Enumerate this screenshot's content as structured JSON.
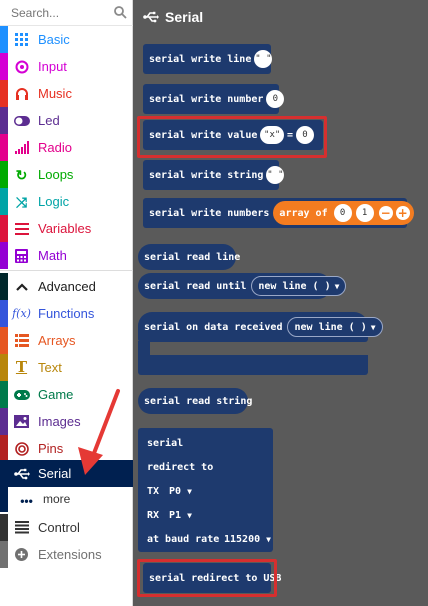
{
  "search": {
    "placeholder": "Search..."
  },
  "categories": [
    {
      "label": "Basic",
      "icon": "grid-icon",
      "color": "#1e90ff"
    },
    {
      "label": "Input",
      "icon": "target-icon",
      "color": "#d400d4"
    },
    {
      "label": "Music",
      "icon": "headphones-icon",
      "color": "#e63022"
    },
    {
      "label": "Led",
      "icon": "toggle-icon",
      "color": "#5c2d91"
    },
    {
      "label": "Radio",
      "icon": "signal-bars-icon",
      "color": "#e3008c"
    },
    {
      "label": "Loops",
      "icon": "loop-arrow-icon",
      "color": "#00aa00"
    },
    {
      "label": "Logic",
      "icon": "shuffle-icon",
      "color": "#00a4a6"
    },
    {
      "label": "Variables",
      "icon": "list-lines-icon",
      "color": "#dc143c"
    },
    {
      "label": "Math",
      "icon": "calculator-icon",
      "color": "#9400d3"
    }
  ],
  "advanced": [
    {
      "label": "Advanced",
      "icon": "chevron-up-icon",
      "color": "#00272b"
    },
    {
      "label": "Functions",
      "icon": "function-icon",
      "color": "#3455db"
    },
    {
      "label": "Arrays",
      "icon": "array-list-icon",
      "color": "#e65722"
    },
    {
      "label": "Text",
      "icon": "text-t-icon",
      "color": "#b8860b"
    },
    {
      "label": "Game",
      "icon": "gamepad-icon",
      "color": "#007a4b"
    },
    {
      "label": "Images",
      "icon": "image-icon",
      "color": "#5c2d91"
    },
    {
      "label": "Pins",
      "icon": "pin-target-icon",
      "color": "#b22222"
    },
    {
      "label": "Serial",
      "icon": "usb-icon",
      "color": "#002050"
    },
    {
      "label": "more",
      "icon": "dots-icon",
      "color": "#002050"
    },
    {
      "label": "Control",
      "icon": "control-lines-icon",
      "color": "#333333"
    },
    {
      "label": "Extensions",
      "icon": "plus-circle-icon",
      "color": "#717171"
    }
  ],
  "flyout": {
    "title": "Serial",
    "write_line": {
      "label": "serial write line",
      "value": "\" \""
    },
    "write_number": {
      "label": "serial write number",
      "value": "0"
    },
    "write_value": {
      "label": "serial write value",
      "key": "\"x\"",
      "eq": "=",
      "value": "0"
    },
    "write_string": {
      "label": "serial write string",
      "value": "\" \""
    },
    "write_numbers": {
      "label": "serial write numbers",
      "array_label": "array of",
      "v1": "0",
      "v2": "1",
      "minus": "−",
      "plus": "+"
    },
    "read_line": {
      "label": "serial read line"
    },
    "read_until": {
      "label": "serial read until",
      "option": "new line ( )"
    },
    "on_received": {
      "label": "serial on data received",
      "option": "new line ( )"
    },
    "read_string": {
      "label": "serial read string"
    },
    "redirect": {
      "label1": "serial",
      "label2": "redirect to",
      "tx_label": "TX",
      "tx_value": "P0",
      "rx_label": "RX",
      "rx_value": "P1",
      "baud_label": "at baud rate",
      "baud_value": "115200"
    },
    "redirect_usb": {
      "label": "serial redirect to USB"
    }
  },
  "colors": {
    "block": "#1e3a6e",
    "array_block": "#f47c20",
    "workspace": "#5a5a5a",
    "highlight": "#d62f2f",
    "arrow": "#e53935"
  }
}
